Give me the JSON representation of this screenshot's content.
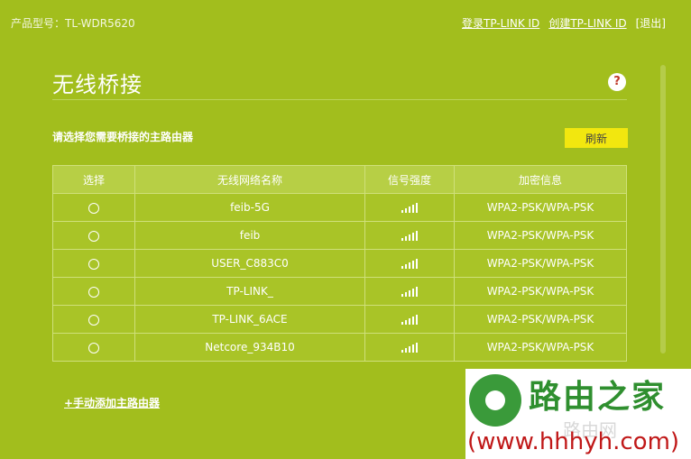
{
  "header": {
    "model_text": "产品型号：TL-WDR5620",
    "login_link": "登录TP-LINK ID",
    "create_link": "创建TP-LINK ID",
    "logout_link": "[退出]"
  },
  "panel": {
    "title": "无线桥接",
    "help_symbol": "?",
    "subtitle": "请选择您需要桥接的主路由器",
    "refresh_label": "刷新"
  },
  "table": {
    "headers": [
      "选择",
      "无线网络名称",
      "信号强度",
      "加密信息"
    ],
    "rows": [
      {
        "ssid": "feib-5G",
        "signal_level": 5,
        "encryption": "WPA2-PSK/WPA-PSK"
      },
      {
        "ssid": "feib",
        "signal_level": 5,
        "encryption": "WPA2-PSK/WPA-PSK"
      },
      {
        "ssid": "USER_C883C0",
        "signal_level": 5,
        "encryption": "WPA2-PSK/WPA-PSK"
      },
      {
        "ssid": "TP-LINK_",
        "signal_level": 5,
        "encryption": "WPA2-PSK/WPA-PSK"
      },
      {
        "ssid": "TP-LINK_6ACE",
        "signal_level": 5,
        "encryption": "WPA2-PSK/WPA-PSK"
      },
      {
        "ssid": "Netcore_934B10",
        "signal_level": 5,
        "encryption": "WPA2-PSK/WPA-PSK"
      }
    ]
  },
  "add_router_link": "+手动添加主路由器",
  "watermark": {
    "brand_cn": "路由之家",
    "brand_sub": "路由网",
    "url": "(www.hhhyh.com)"
  },
  "colors": {
    "background": "#a2be1d",
    "button_yellow": "#f2e70f",
    "help_red": "#c0392b"
  }
}
